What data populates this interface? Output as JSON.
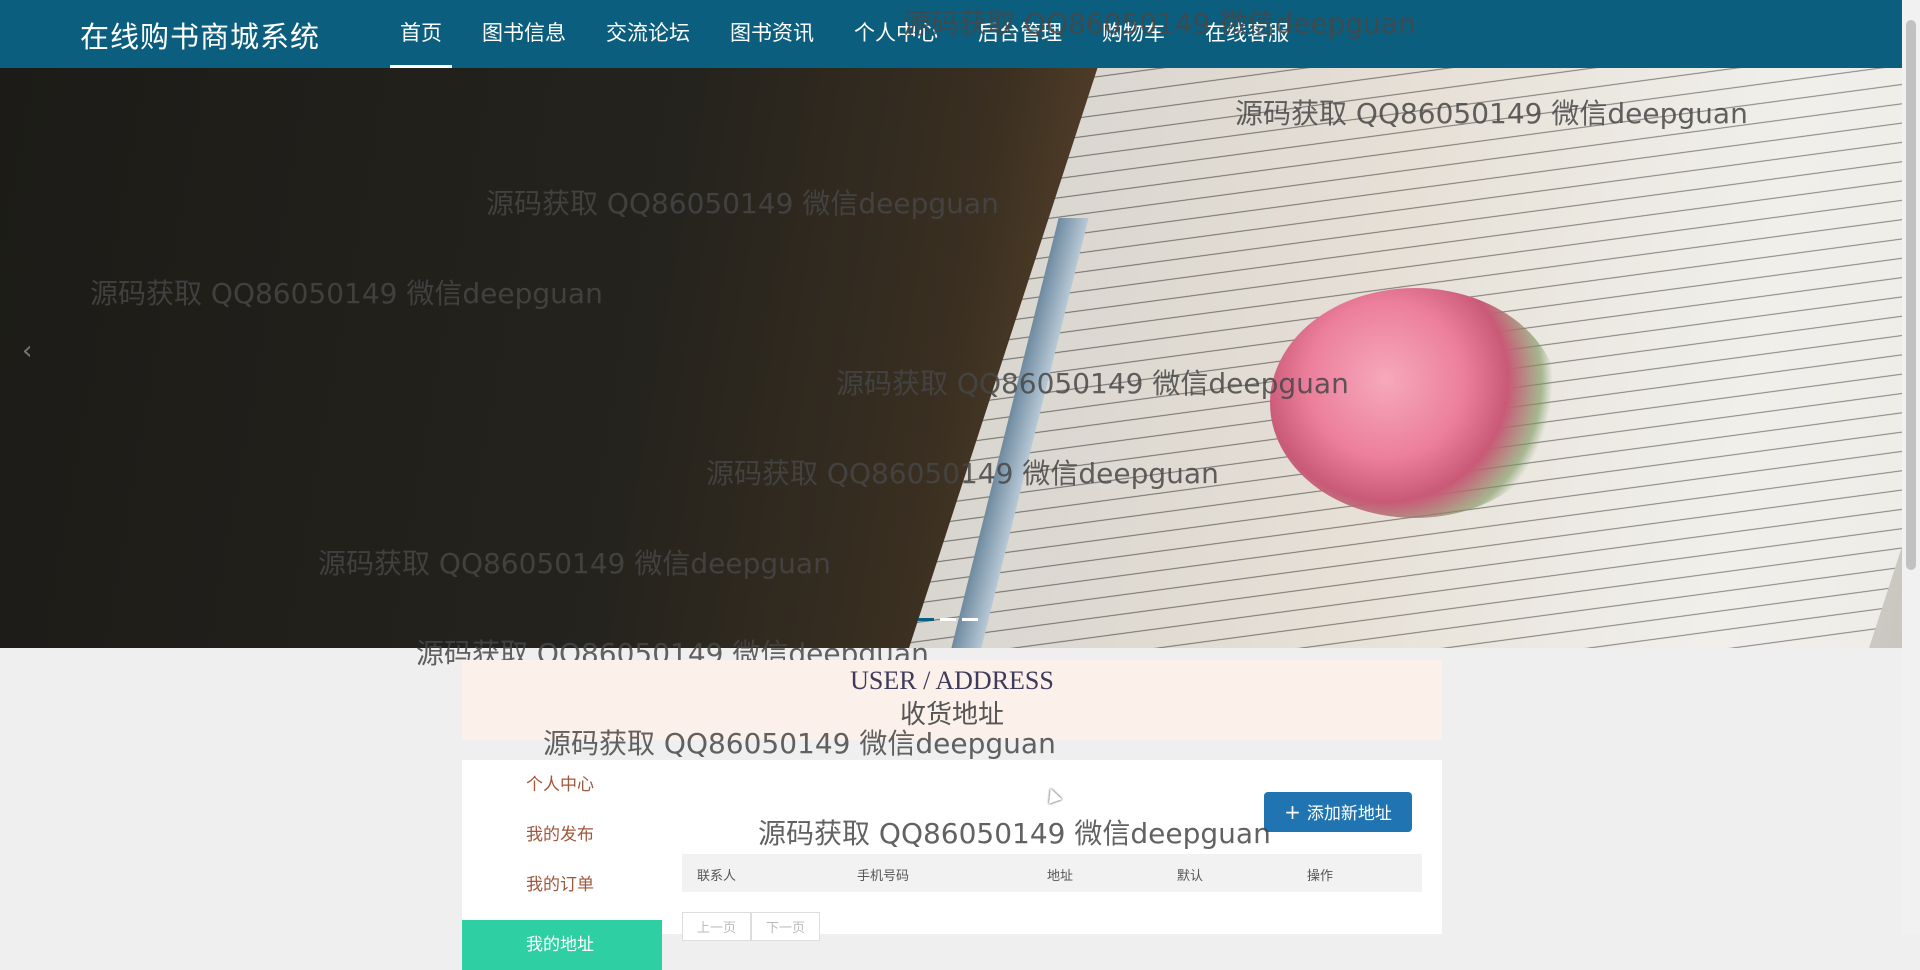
{
  "nav": {
    "brand": "在线购书商城系统",
    "items": [
      {
        "label": "首页",
        "active": true
      },
      {
        "label": "图书信息"
      },
      {
        "label": "交流论坛"
      },
      {
        "label": "图书资讯"
      },
      {
        "label": "个人中心"
      },
      {
        "label": "后台管理"
      },
      {
        "label": "购物车"
      },
      {
        "label": "在线客服"
      }
    ]
  },
  "banner": {
    "prev_glyph": "‹",
    "dots": 3,
    "active_dot": 0
  },
  "watermark": "源码获取 QQ86050149 微信deepguan",
  "page_title": {
    "en": "USER / ADDRESS",
    "cn": "收货地址"
  },
  "side_menu": {
    "items": [
      {
        "label": "个人中心"
      },
      {
        "label": "我的发布"
      },
      {
        "label": "我的订单"
      },
      {
        "label": "我的地址",
        "active": true
      }
    ]
  },
  "add_button": {
    "icon": "plus-icon",
    "label": "添加新地址"
  },
  "table": {
    "columns": [
      "联系人",
      "手机号码",
      "地址",
      "默认",
      "操作"
    ]
  },
  "pager": {
    "prev": "上一页",
    "next": "下一页"
  },
  "colors": {
    "nav_bg": "#0b5e7e",
    "active_menu": "#2ecfa2",
    "button": "#1f74b1",
    "menu_text": "#a0573c"
  }
}
